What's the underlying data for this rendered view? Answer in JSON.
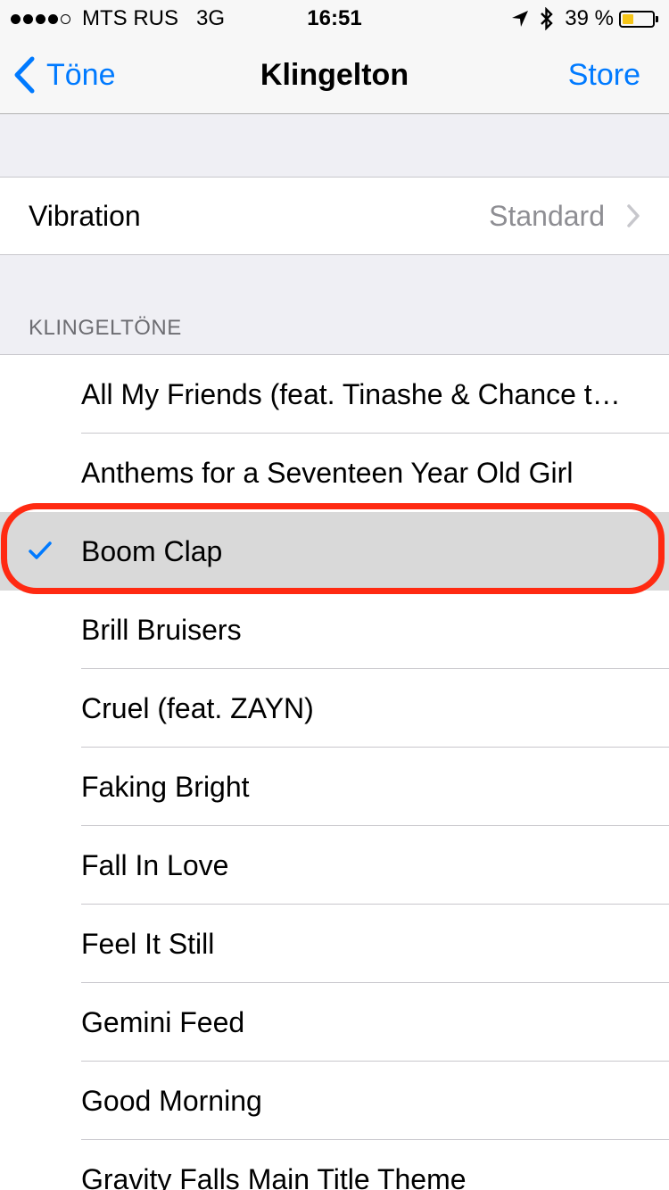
{
  "status_bar": {
    "signal_bars_filled": 4,
    "signal_bars_total": 5,
    "carrier": "MTS RUS",
    "network": "3G",
    "time": "16:51",
    "battery_percent_label": "39 %",
    "battery_level": 0.39,
    "battery_color": "#f5c518",
    "icons": [
      "location-arrow-icon",
      "bluetooth-icon"
    ]
  },
  "nav": {
    "back_label": "Töne",
    "title": "Klingelton",
    "right_label": "Store",
    "accent_color": "#007aff"
  },
  "vibration": {
    "label": "Vibration",
    "value": "Standard"
  },
  "section": {
    "header": "KLINGELTÖNE"
  },
  "ringtones": {
    "selected_index": 2,
    "items": [
      "All My Friends (feat. Tinashe & Chance the Rapper)",
      "Anthems for a Seventeen Year Old Girl",
      "Boom Clap",
      "Brill Bruisers",
      "Cruel (feat. ZAYN)",
      "Faking Bright",
      "Fall In Love",
      "Feel It Still",
      "Gemini Feed",
      "Good Morning",
      "Gravity Falls Main Title Theme"
    ]
  },
  "annotation": {
    "highlight_color": "#ff2a12"
  }
}
